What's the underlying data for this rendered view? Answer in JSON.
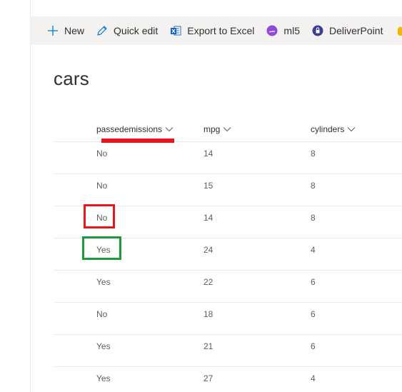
{
  "toolbar": {
    "items": [
      {
        "label": "New",
        "icon": "plus-icon"
      },
      {
        "label": "Quick edit",
        "icon": "pencil-icon"
      },
      {
        "label": "Export to Excel",
        "icon": "excel-icon"
      },
      {
        "label": "ml5",
        "icon": "ml5-icon"
      },
      {
        "label": "DeliverPoint",
        "icon": "deliverpoint-icon"
      }
    ]
  },
  "list": {
    "title": "cars",
    "columns": [
      "passedemissions",
      "mpg",
      "cylinders"
    ],
    "rows": [
      [
        "No",
        "14",
        "8"
      ],
      [
        "No",
        "15",
        "8"
      ],
      [
        "No",
        "14",
        "8"
      ],
      [
        "Yes",
        "24",
        "4"
      ],
      [
        "Yes",
        "22",
        "6"
      ],
      [
        "No",
        "18",
        "6"
      ],
      [
        "Yes",
        "21",
        "6"
      ],
      [
        "Yes",
        "27",
        "4"
      ]
    ]
  },
  "colors": {
    "command_bar_bg": "#f3f2f1",
    "accent": "#0078d4",
    "annotation_red": "#e8141c",
    "annotation_green": "#1a9c3a"
  }
}
